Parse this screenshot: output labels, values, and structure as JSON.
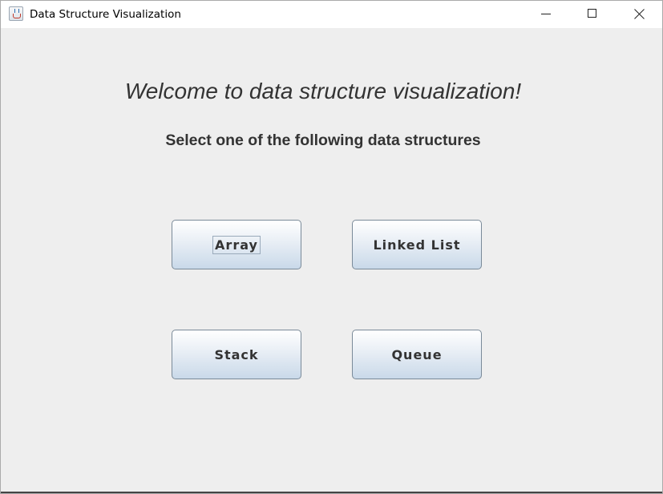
{
  "window": {
    "title": "Data Structure Visualization",
    "controls": [
      "minimize-icon",
      "maximize-icon",
      "close-icon"
    ]
  },
  "main": {
    "heading": "Welcome to data structure visualization!",
    "subheading": "Select one of the following data structures",
    "buttons": [
      {
        "label": "Array",
        "focused": true
      },
      {
        "label": "Linked List",
        "focused": false
      },
      {
        "label": "Stack",
        "focused": false
      },
      {
        "label": "Queue",
        "focused": false
      }
    ]
  },
  "colors": {
    "background": "#eeeeee",
    "text": "#333333",
    "button_border": "#7a8a99",
    "button_gradient_bottom": "#c9d9e9"
  }
}
